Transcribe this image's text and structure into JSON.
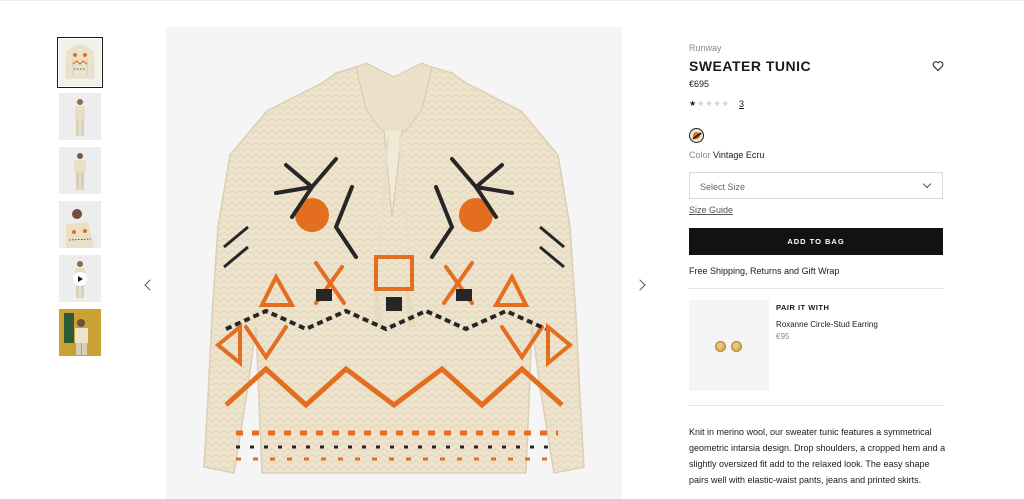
{
  "product": {
    "collection": "Runway",
    "title": "SWEATER TUNIC",
    "price": "€695",
    "rating": 1,
    "rating_max": 5,
    "review_count": "3",
    "color_label": "Color",
    "color_value": "Vintage Ecru",
    "size_placeholder": "Select Size",
    "size_guide": "Size Guide",
    "add_to_bag": "ADD TO BAG",
    "shipping_note": "Free Shipping, Returns and Gift Wrap",
    "description": "Knit in merino wool, our sweater tunic features a symmetrical geometric intarsia design. Drop shoulders, a cropped hem and a slightly oversized fit add to the relaxed look. The easy shape pairs well with elastic-waist pants, jeans and printed skirts."
  },
  "pair_with": {
    "heading": "PAIR IT WITH",
    "name": "Roxanne Circle-Stud Earring",
    "price": "€95"
  },
  "gallery": {
    "thumbnails": [
      "sweater-flat",
      "model-front",
      "model-side",
      "model-closeup",
      "video",
      "model-editorial"
    ],
    "active_index": 0
  },
  "icons": {
    "wishlist": "heart-icon",
    "prev": "chevron-left-icon",
    "next": "chevron-right-icon",
    "select": "chevron-down-icon",
    "video": "play-icon"
  },
  "colors": {
    "accent_orange": "#e46e20",
    "ecru": "#efe4cf",
    "dark": "#121212"
  }
}
